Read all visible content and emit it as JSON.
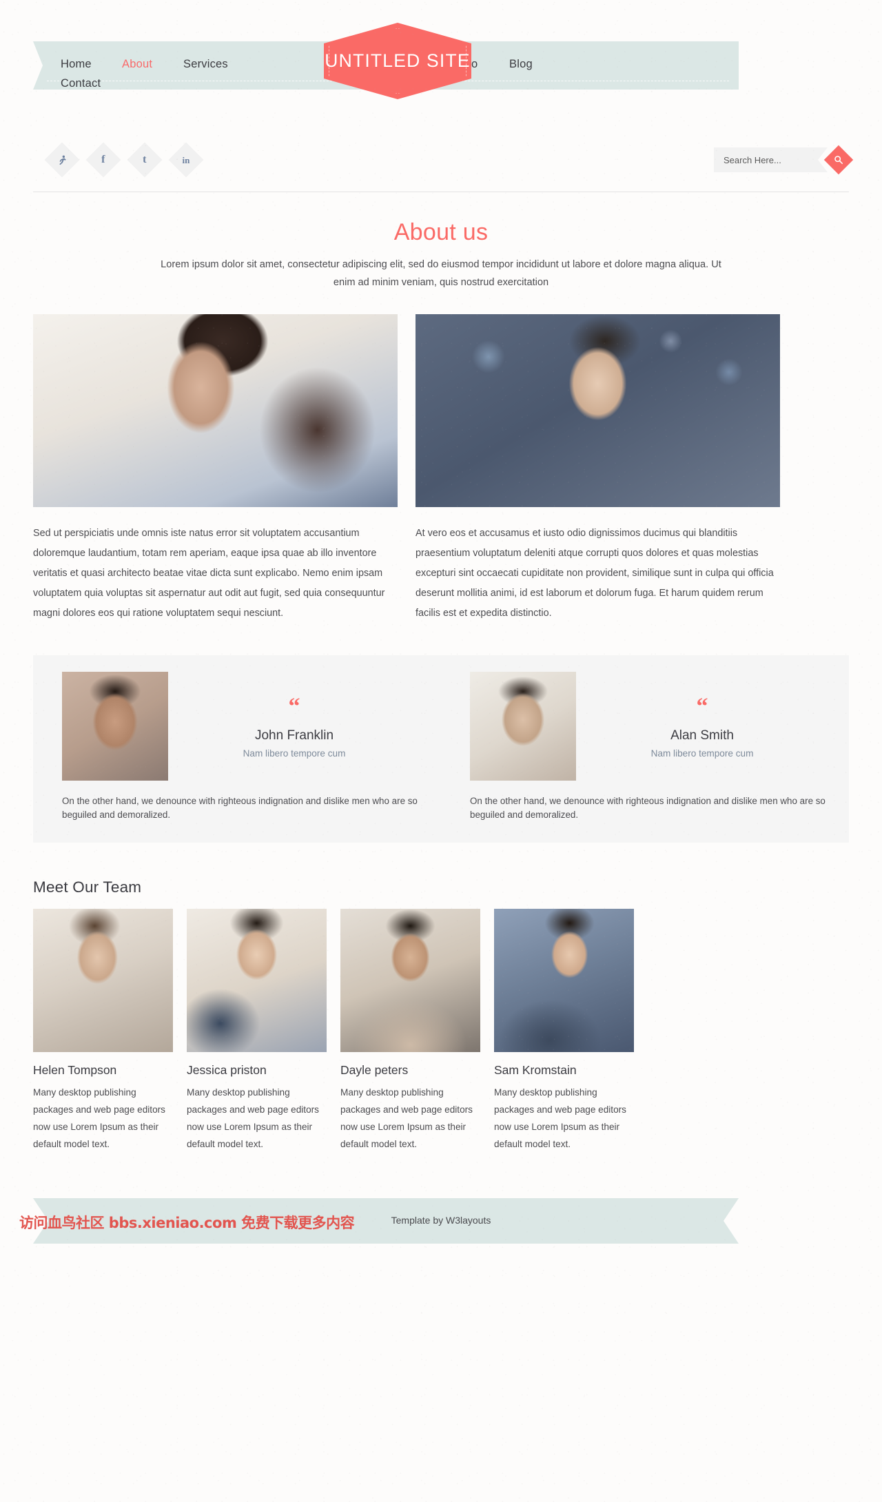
{
  "brand": {
    "logo_text": "UNTITLED SITE"
  },
  "nav": {
    "home": "Home",
    "about": "About",
    "services": "Services",
    "portfolio": "Portfolio",
    "blog": "Blog",
    "contact": "Contact"
  },
  "social": [
    {
      "name": "dribbble",
      "glyph": ""
    },
    {
      "name": "facebook",
      "glyph": "f"
    },
    {
      "name": "twitter",
      "glyph": "t"
    },
    {
      "name": "linkedin",
      "glyph": "in"
    }
  ],
  "search": {
    "placeholder": "Search Here...",
    "value": ""
  },
  "about": {
    "title": "About us",
    "subtitle": "Lorem ipsum dolor sit amet, consectetur adipiscing elit, sed do eiusmod tempor incididunt ut labore et dolore magna aliqua. Ut enim ad minim veniam, quis nostrud exercitation",
    "left_paragraph": "Sed ut perspiciatis unde omnis iste natus error sit voluptatem accusantium doloremque laudantium, totam rem aperiam, eaque ipsa quae ab illo inventore veritatis et quasi architecto beatae vitae dicta sunt explicabo. Nemo enim ipsam voluptatem quia voluptas sit aspernatur aut odit aut fugit, sed quia consequuntur magni dolores eos qui ratione voluptatem sequi nesciunt.",
    "right_paragraph": "At vero eos et accusamus et iusto odio dignissimos ducimus qui blanditiis praesentium voluptatum deleniti atque corrupti quos dolores et quas molestias excepturi sint occaecati cupiditate non provident, similique sunt in culpa qui officia deserunt mollitia animi, id est laborum et dolorum fuga. Et harum quidem rerum facilis est et expedita distinctio."
  },
  "testimonials": [
    {
      "quote_mark": "“",
      "name": "John Franklin",
      "role": "Nam libero tempore cum",
      "text": "On the other hand, we denounce with righteous indignation and dislike men who are so beguiled and demoralized."
    },
    {
      "quote_mark": "“",
      "name": "Alan Smith",
      "role": "Nam libero tempore cum",
      "text": "On the other hand, we denounce with righteous indignation and dislike men who are so beguiled and demoralized."
    }
  ],
  "team": {
    "title": "Meet Our Team",
    "members": [
      {
        "name": "Helen Tompson",
        "desc": "Many desktop publishing packages and web page editors now use Lorem Ipsum as their default model text."
      },
      {
        "name": "Jessica priston",
        "desc": "Many desktop publishing packages and web page editors now use Lorem Ipsum as their default model text."
      },
      {
        "name": "Dayle peters",
        "desc": "Many desktop publishing packages and web page editors now use Lorem Ipsum as their default model text."
      },
      {
        "name": "Sam Kromstain",
        "desc": "Many desktop publishing packages and web page editors now use Lorem Ipsum as their default model text."
      }
    ]
  },
  "footer": {
    "text": "Template by W3layouts",
    "watermark": "访问血鸟社区 bbs.xieniao.com 免费下载更多内容"
  },
  "colors": {
    "accent": "#fa6a66",
    "band": "#dbe7e5",
    "testi_bg": "#f5f5f5",
    "page_bg": "#fdfcfb",
    "text": "#4b4b4f"
  }
}
